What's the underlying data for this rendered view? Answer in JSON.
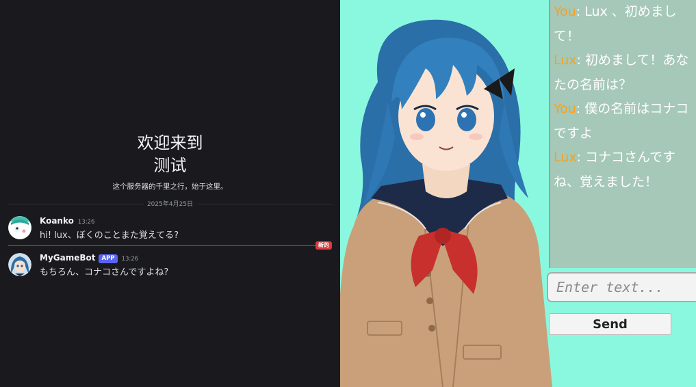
{
  "discord": {
    "welcome_line1": "欢迎来到",
    "welcome_line2": "测试",
    "welcome_sub": "这个服务器的千里之行，始于这里。",
    "date": "2025年4月25日",
    "new_badge": "新的",
    "messages": [
      {
        "author": "Koanko",
        "time": "13:26",
        "badge": "",
        "text": "hi! lux、ぼくのことまた覚えてる?"
      },
      {
        "author": "MyGameBot",
        "time": "13:26",
        "badge": "APP",
        "text": "もちろん、コナコさんですよね?"
      }
    ]
  },
  "vn": {
    "log": [
      {
        "speaker": "You",
        "sep": ": ",
        "text": "Lux 、初めまして！"
      },
      {
        "speaker": "Lux",
        "sep": ": ",
        "text": "初めまして！あなたの名前は？"
      },
      {
        "speaker": "You",
        "sep": ": ",
        "text": "僕の名前はコナコですよ"
      },
      {
        "speaker": "Lux",
        "sep": ": ",
        "text": "コナコさんですね、覚えました！"
      }
    ],
    "input_placeholder": "Enter text...",
    "send_label": "Send"
  },
  "colors": {
    "vn_background": "#89f8df",
    "speaker": "#f5a21e",
    "discord_bg": "#1a1a1e",
    "app_badge": "#5865f2",
    "new_badge": "#d83c3e"
  }
}
